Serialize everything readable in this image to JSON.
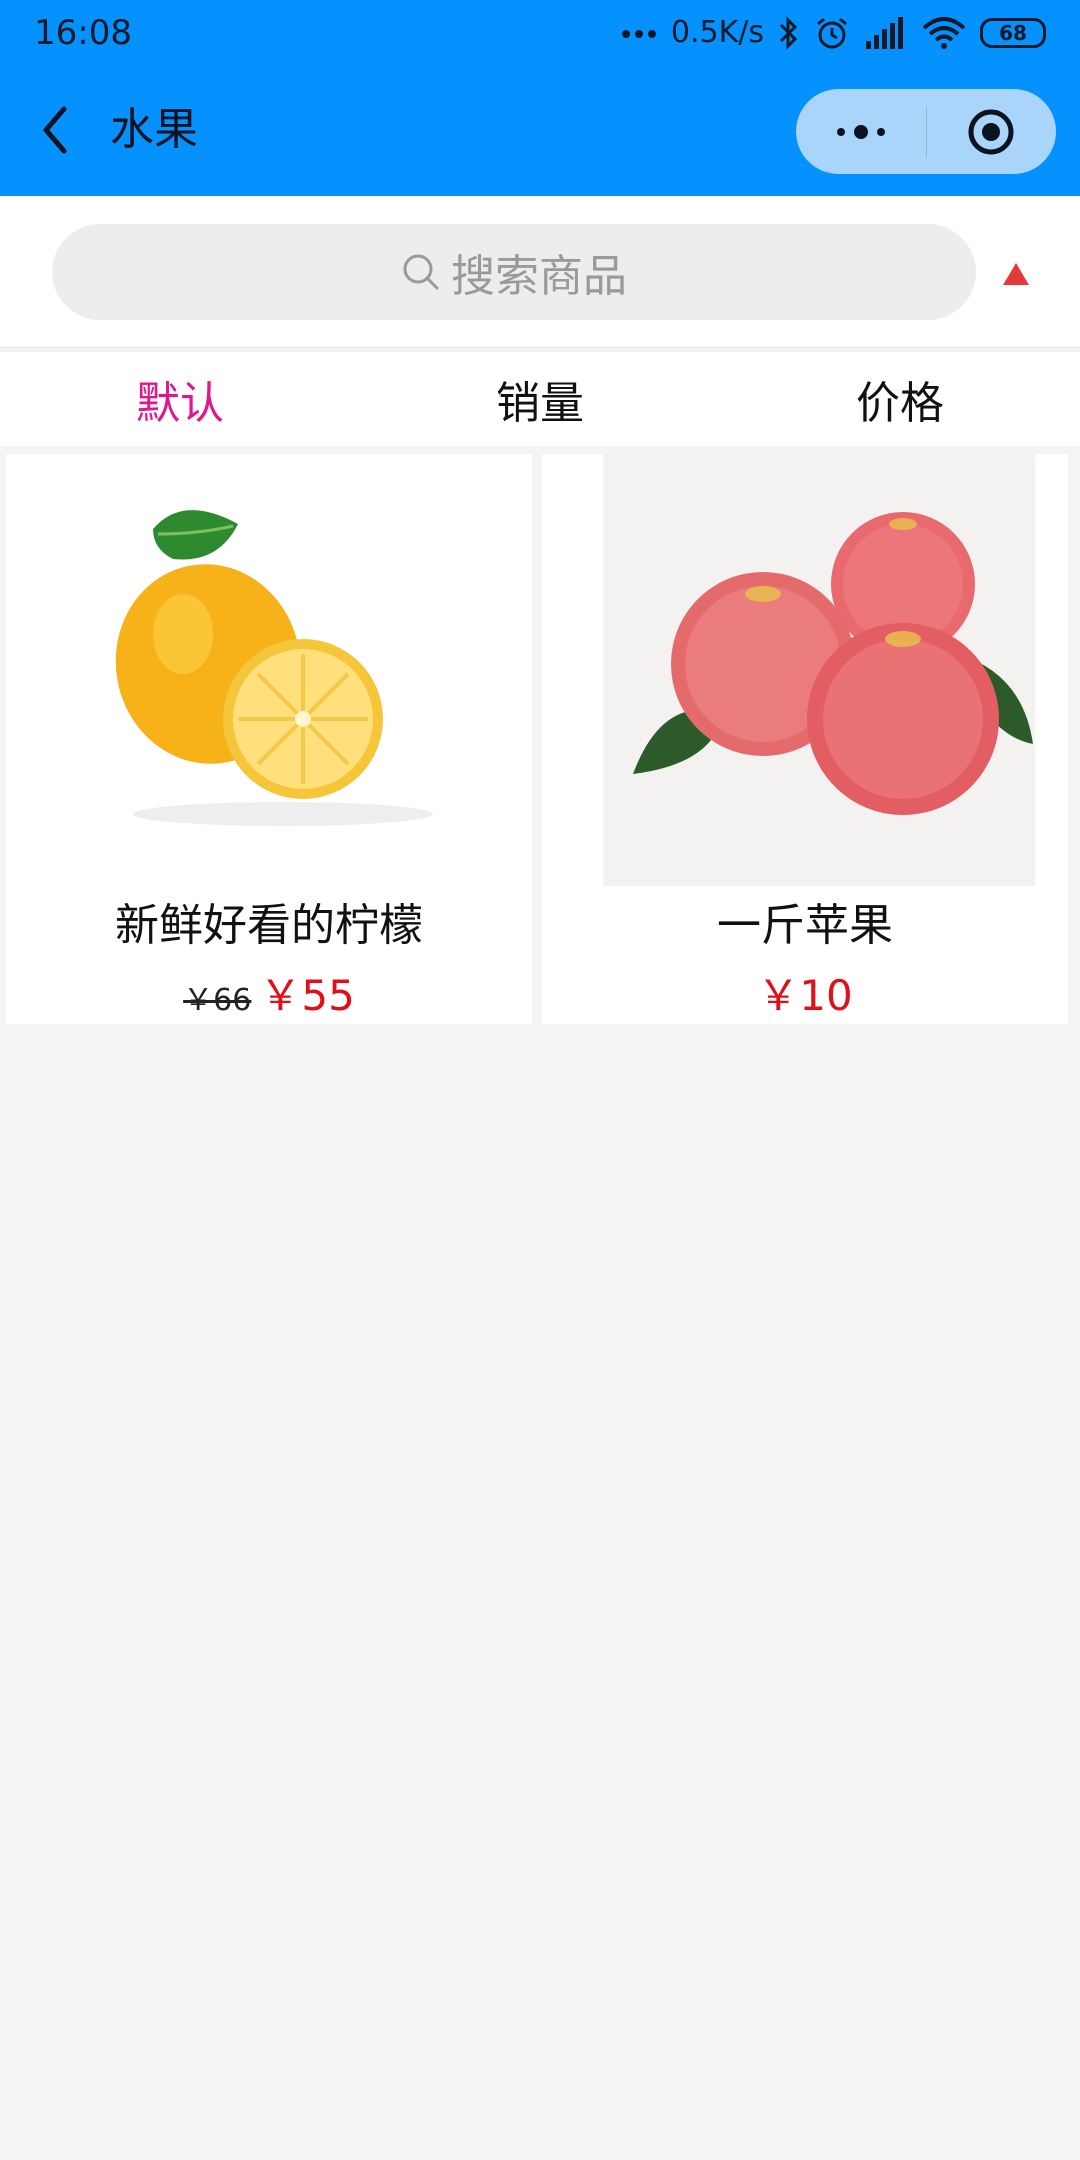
{
  "status_bar": {
    "time": "16:08",
    "network_speed": "0.5K/s",
    "battery": "68",
    "icons": [
      "dots-icon",
      "bluetooth-icon",
      "alarm-icon",
      "signal-icon",
      "wifi-icon",
      "battery-icon"
    ]
  },
  "nav": {
    "title": "水果",
    "back_icon": "chevron-left-icon",
    "capsule_icons": [
      "more-dots-icon",
      "home-target-icon"
    ]
  },
  "search": {
    "placeholder": "搜索商品",
    "icon": "search-icon",
    "sort_icon": "triangle-up-icon"
  },
  "tabs": [
    {
      "label": "默认",
      "active": true
    },
    {
      "label": "销量",
      "active": false
    },
    {
      "label": "价格",
      "active": false
    }
  ],
  "products": [
    {
      "name": "新鲜好看的柠檬",
      "old_price": "￥66",
      "price": "￥55",
      "image": "lemon"
    },
    {
      "name": "一斤苹果",
      "old_price": "",
      "price": "￥10",
      "image": "apples"
    }
  ],
  "colors": {
    "accent_blue": "#0592fe",
    "active_tab": "#e0168e",
    "price_red": "#e0101a",
    "background": "#f4f4f4"
  }
}
